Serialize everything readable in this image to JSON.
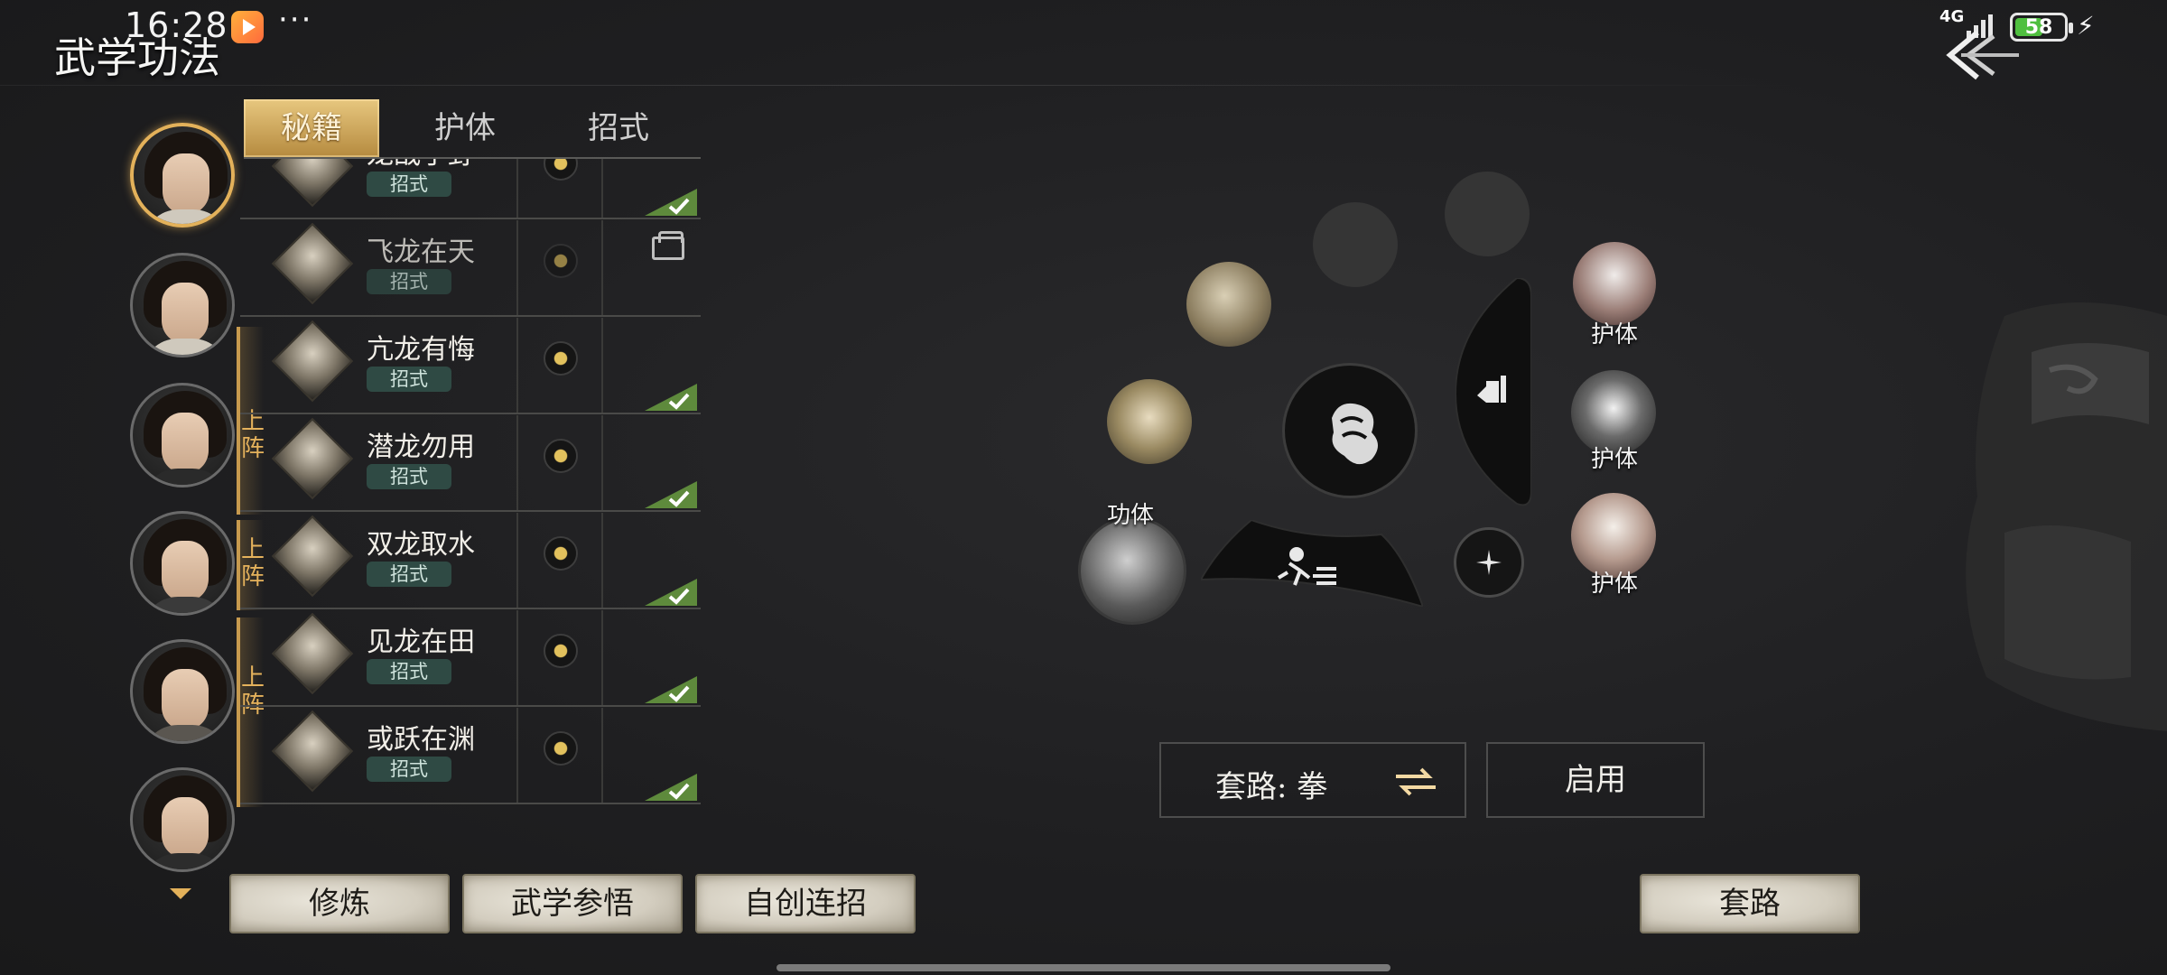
{
  "status_bar": {
    "time": "16:28",
    "more": "···",
    "network": "4G",
    "battery": "58",
    "battery_level": 0.58
  },
  "page": {
    "title": "武学功法"
  },
  "tabs": [
    {
      "label": "秘籍",
      "active": true
    },
    {
      "label": "护体",
      "active": false
    },
    {
      "label": "招式",
      "active": false
    }
  ],
  "formation": {
    "label_line1": "上",
    "label_line2": "阵"
  },
  "skills": [
    {
      "name": "龙战于野",
      "tag": "招式",
      "equipped": true,
      "locked": false
    },
    {
      "name": "飞龙在天",
      "tag": "招式",
      "equipped": false,
      "locked": true
    },
    {
      "name": "亢龙有悔",
      "tag": "招式",
      "equipped": true,
      "locked": false
    },
    {
      "name": "潜龙勿用",
      "tag": "招式",
      "equipped": true,
      "locked": false
    },
    {
      "name": "双龙取水",
      "tag": "招式",
      "equipped": true,
      "locked": false
    },
    {
      "name": "见龙在田",
      "tag": "招式",
      "equipped": true,
      "locked": false
    },
    {
      "name": "或跃在渊",
      "tag": "招式",
      "equipped": true,
      "locked": false
    }
  ],
  "bottom_buttons": {
    "train": "修炼",
    "comprehend": "武学参悟",
    "custom_combo": "自创连招",
    "routine": "套路"
  },
  "wheel": {
    "slot_labels": {
      "guard_1": "护体",
      "guard_2": "护体",
      "guard_3": "护体",
      "core": "功体"
    }
  },
  "route": {
    "label": "套路: 拳",
    "enable": "启用"
  },
  "icons": {
    "back": "back-arrow-icon",
    "swap": "swap-arrows-icon",
    "check": "check-mark-icon",
    "lock": "lock-icon",
    "coin": "coin-icon"
  },
  "colors": {
    "accent_gold": "#e3b15a",
    "check_green": "#5e8a3c",
    "tag_teal": "#2f4a44"
  }
}
